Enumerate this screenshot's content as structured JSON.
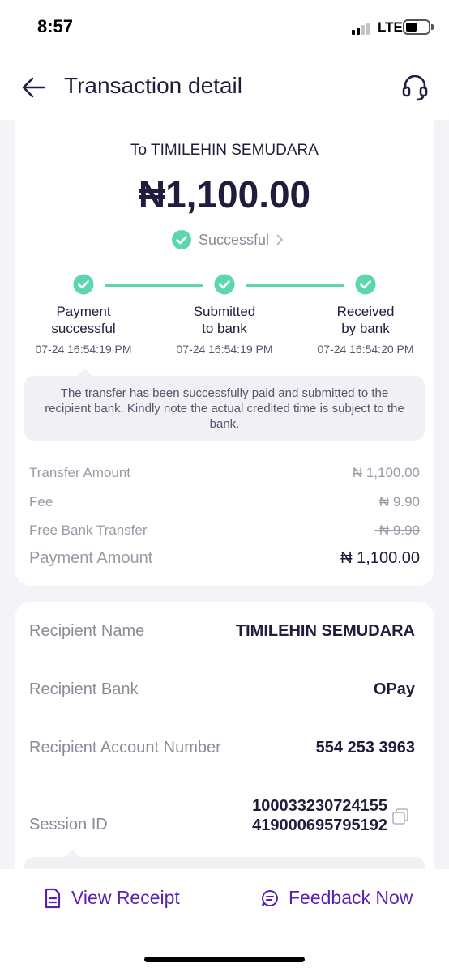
{
  "status_bar": {
    "time": "8:57",
    "network": "LTE"
  },
  "header": {
    "title": "Transaction detail"
  },
  "transaction": {
    "to_label": "To TIMILEHIN SEMUDARA",
    "amount": "₦1,100.00",
    "status": "Successful"
  },
  "steps": [
    {
      "label_line1": "Payment",
      "label_line2": "successful",
      "time": "07-24 16:54:19 PM"
    },
    {
      "label_line1": "Submitted",
      "label_line2": "to bank",
      "time": "07-24 16:54:19 PM"
    },
    {
      "label_line1": "Received",
      "label_line2": "by bank",
      "time": "07-24 16:54:20 PM"
    }
  ],
  "note": "The transfer has been successfully paid and submitted to the recipient bank. Kindly note the actual credited time is subject to the bank.",
  "fees": {
    "transfer_amount": {
      "label": "Transfer Amount",
      "value": "₦ 1,100.00"
    },
    "fee": {
      "label": "Fee",
      "value": "₦ 9.90"
    },
    "free_bank_transfer": {
      "label": "Free Bank Transfer",
      "value": "-₦ 9.90"
    },
    "payment_amount": {
      "label": "Payment Amount",
      "value": "₦ 1,100.00"
    }
  },
  "recipient": {
    "name": {
      "label": "Recipient Name",
      "value": "TIMILEHIN SEMUDARA"
    },
    "bank": {
      "label": "Recipient Bank",
      "value": "OPay"
    },
    "account": {
      "label": "Recipient Account Number",
      "value": "554 253 3963"
    },
    "session": {
      "label": "Session ID",
      "value_line1": "100033230724155",
      "value_line2": "419000695795192"
    }
  },
  "actions": {
    "view_receipt": "View Receipt",
    "feedback": "Feedback Now"
  },
  "colors": {
    "accent": "#5a1fb5",
    "success": "#5cd6b1",
    "text": "#1f1d3b"
  },
  "icons": [
    "back-arrow-icon",
    "headset-icon",
    "check-circle-icon",
    "chevron-right-icon",
    "copy-icon",
    "receipt-icon",
    "chat-icon"
  ]
}
